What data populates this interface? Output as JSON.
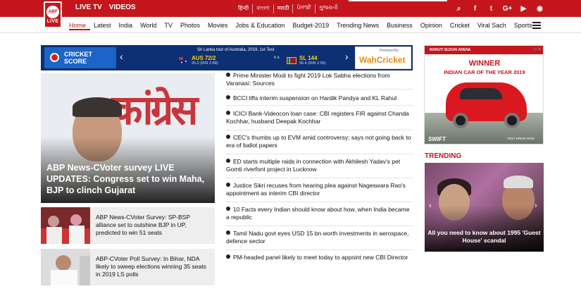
{
  "header": {
    "logo_top": "ABP",
    "logo_bottom": "LIVE",
    "links": [
      "LIVE TV",
      "VIDEOS"
    ],
    "languages": [
      "हिन्दी",
      "বাংলা",
      "मराठी",
      "ਪੰਜਾਬੀ",
      "ગુજરાતી"
    ],
    "icons": {
      "search": "⌕",
      "facebook": "f",
      "twitter": "t",
      "google": "G+",
      "youtube": "▶",
      "rss": "◉"
    }
  },
  "nav": {
    "items": [
      "Home",
      "Latest",
      "India",
      "World",
      "TV",
      "Photos",
      "Movies",
      "Jobs & Education",
      "Budget-2019",
      "Trending News",
      "Business",
      "Opinion",
      "Cricket",
      "Viral Sach",
      "Sports"
    ]
  },
  "cricket": {
    "label_line1": "CRICKET",
    "label_line2": "SCORE",
    "match": "Sri Lanka tour of Australia, 2019, 1st Test",
    "team1": {
      "name": "AUS",
      "score": "72/2",
      "detail": "25.0  (R/R 2.88)"
    },
    "vs": "v\ns",
    "team2": {
      "name": "SL",
      "score": "144",
      "detail": "56.4  (R/R 2.55)"
    },
    "powered_by": "Powered By",
    "sponsor": "WahCricket"
  },
  "hero": {
    "title": "ABP News-CVoter survey LIVE UPDATES: Congress set to win Maha, BJP to clinch Gujarat",
    "bg_text": "कांग्रेस"
  },
  "cards": [
    {
      "title": "ABP News-CVoter Survey: SP-BSP alliance set to outshine BJP in UP, predicted to win 51 seats"
    },
    {
      "title": "ABP-CVoter Poll Survey: In Bihar, NDA likely to sweep elections winning 35 seats in 2019 LS polls"
    }
  ],
  "news": [
    "Prime Minister Modi to fight 2019 Lok Sabha elections from Varanasi: Sources",
    "BCCI lifts interim suspension on Hardik Pandya and KL Rahul",
    "ICICI Bank-Videocon loan case: CBI registers FIR against Chanda Kochhar, husband Deepak Kochhar",
    "CEC's thumbs up to EVM amid controversy; says not going back to era of ballot papers",
    "ED starts multiple raids in connection with Akhilesh Yadav's pet Gomti riverfont project in Lucknow",
    "Justice Sikri recuses from hearing plea against Nageswara Rao's appointment as interim CBI director",
    "10 Facts every Indian should know about how, when India became a republic",
    "Tamil Nadu govt eyes USD 15 bn worth investments in aerospace, defence sector",
    "PM-headed panel likely to meet today to appoint new CBI Director"
  ],
  "ad": {
    "brand": "MARUTI SUZUKI  ARENA",
    "winner": "WINNER",
    "subtitle": "INDIAN CAR OF THE YEAR 2019",
    "model": "SWIFT",
    "cta": "TEST DRIVE NOW"
  },
  "trending": {
    "heading": "TRENDING",
    "title": "All you need to know about 1995 'Guest House' scandal"
  }
}
